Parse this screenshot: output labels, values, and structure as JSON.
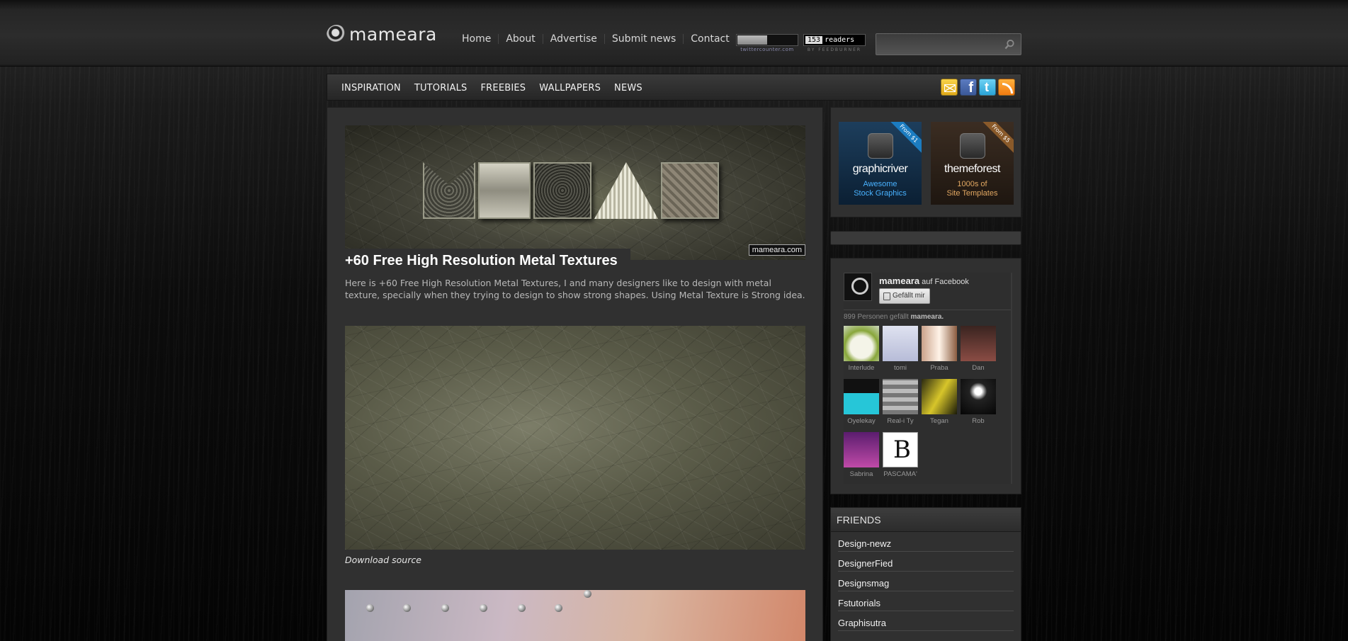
{
  "header": {
    "logo_text": "mameara",
    "nav": [
      "Home",
      "About",
      "Advertise",
      "Submit news",
      "Contact"
    ],
    "twitter_counter_caption": "twittercounter.com",
    "feed_count": "153",
    "feed_label": "readers",
    "feed_caption": "BY FEEDBURNER",
    "search_placeholder": ""
  },
  "categories": [
    "INSPIRATION",
    "TUTORIALS",
    "FREEBIES",
    "WALLPAPERS",
    "NEWS"
  ],
  "social_icons": [
    "mail-icon",
    "facebook-icon",
    "twitter-icon",
    "rss-icon"
  ],
  "post": {
    "hero_watermark": "mameara.com",
    "title": "+60 Free High Resolution Metal Textures",
    "excerpt": "Here is +60 Free High Resolution Metal Textures, I and many designers like to design with metal texture, specially when they trying to design to show strong shapes. Using Metal Texture is Strong idea.",
    "download_label": "Download source"
  },
  "ads": [
    {
      "brand": "graphicriver",
      "ribbon": "From $1",
      "tag_line1": "Awesome",
      "tag_line2": "Stock Graphics"
    },
    {
      "brand": "themeforest",
      "ribbon": "From $5",
      "tag_line1": "1000s of",
      "tag_line2": "Site Templates"
    }
  ],
  "facebook": {
    "page_name": "mameara",
    "page_suffix": "auf Facebook",
    "like_button": "Gefällt mir",
    "count_text": "899 Personen gefällt",
    "count_name": "mameara.",
    "fans": [
      "Interlude",
      "tomi",
      "Praba",
      "Dan",
      "Oyelekay",
      "Real-i Ty",
      "Tegan",
      "Rob",
      "Sabrina",
      "PASCAMA'"
    ]
  },
  "friends": {
    "heading": "FRIENDS",
    "links": [
      "Design-newz",
      "DesignerFied",
      "Designsmag",
      "Fstutorials",
      "Graphisutra"
    ]
  },
  "colors": {
    "page_bg": "#050505",
    "panel_bg": "#303030",
    "graphicriver_tag": "#49b2ff",
    "themeforest_tag": "#e2a862"
  }
}
